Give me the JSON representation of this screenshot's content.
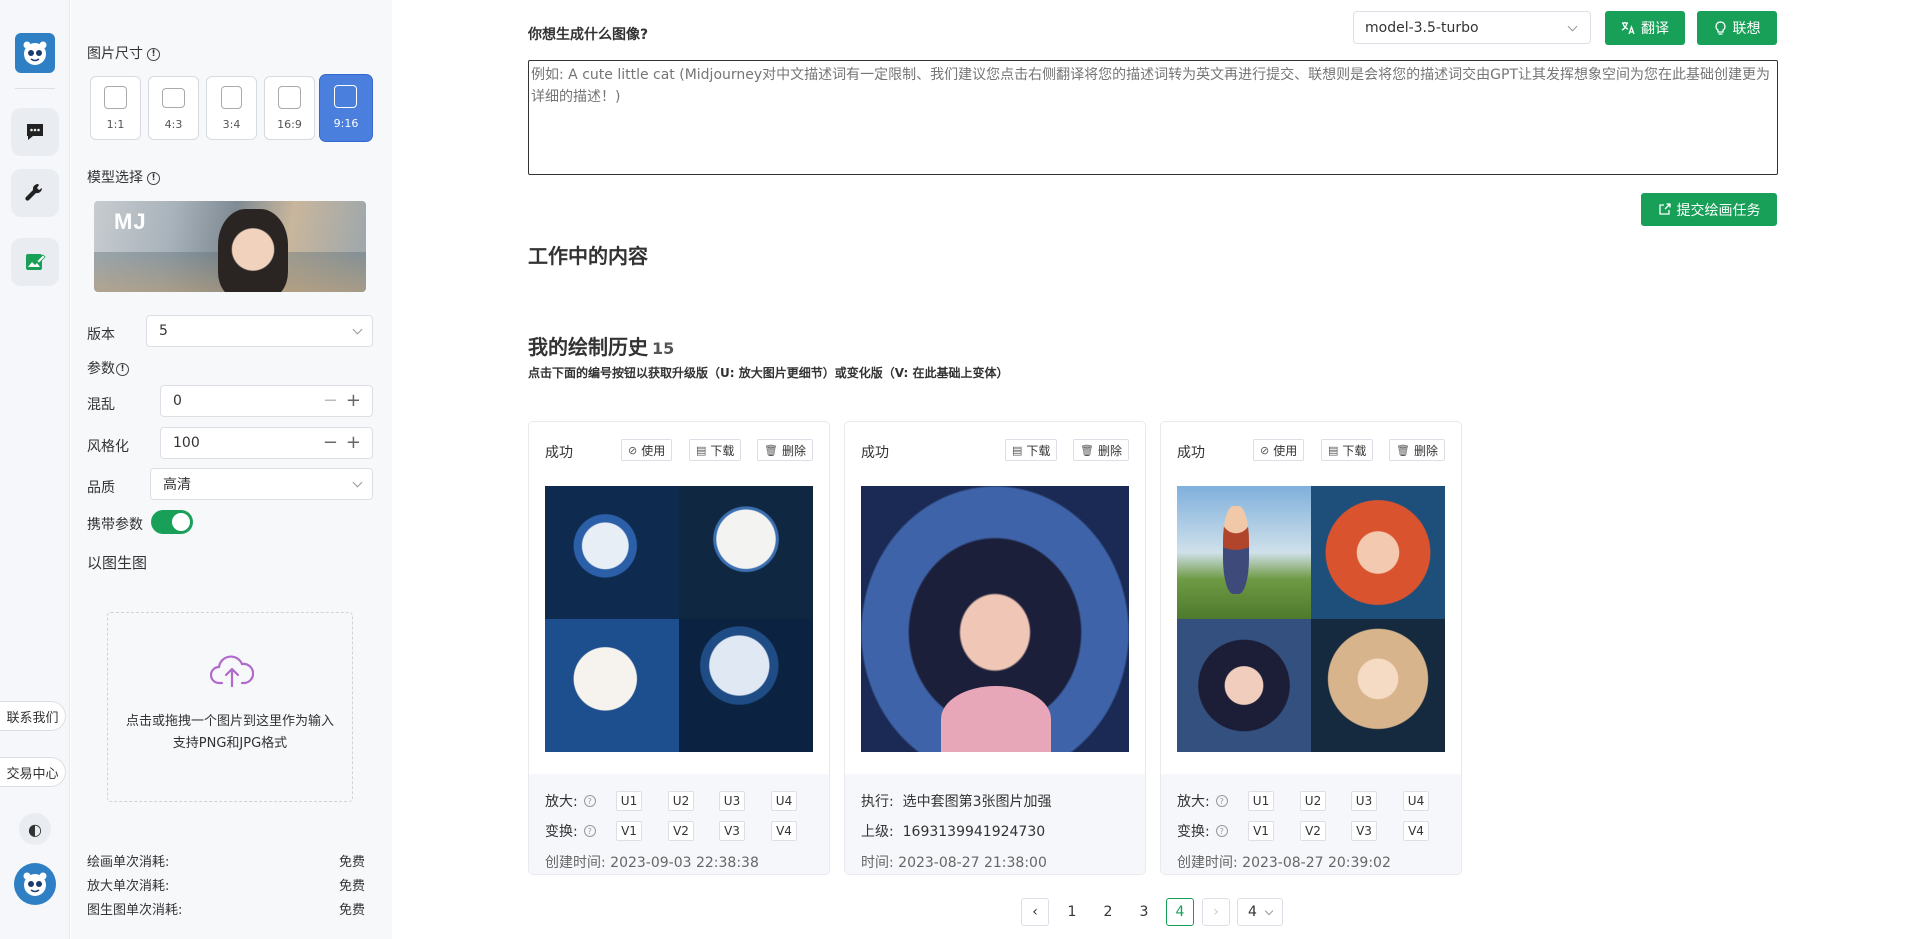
{
  "sidebar_rail": {
    "contact_label": "联系我们",
    "trade_label": "交易中心",
    "theme_glyph": "◐"
  },
  "settings": {
    "size_label": "图片尺寸",
    "ratios": [
      "1:1",
      "4:3",
      "3:4",
      "16:9",
      "9:16"
    ],
    "selected_ratio": "9:16",
    "model_label": "模型选择",
    "model_badge": "MJ",
    "version_label": "版本",
    "version_value": "5",
    "params_label": "参数",
    "chaos_label": "混乱",
    "chaos_value": "0",
    "stylize_label": "风格化",
    "stylize_value": "100",
    "quality_label": "品质",
    "quality_value": "高清",
    "carry_label": "携带参数",
    "carry_on": true,
    "img2img_label": "以图生图",
    "upload_text_1": "点击或拖拽一个图片到这里作为输入",
    "upload_text_2": "支持PNG和JPG格式",
    "costs": [
      {
        "label": "绘画单次消耗:",
        "value": "免费"
      },
      {
        "label": "放大单次消耗:",
        "value": "免费"
      },
      {
        "label": "图生图单次消耗:",
        "value": "免费"
      }
    ]
  },
  "main": {
    "question": "你想生成什么图像?",
    "model_value": "model-3.5-turbo",
    "translate_label": "翻译",
    "associate_label": "联想",
    "prompt_placeholder": "例如: A cute little cat (Midjourney对中文描述词有一定限制、我们建议您点击右侧翻译将您的描述词转为英文再进行提交、联想则是会将您的描述词交由GPT让其发挥想象空间为您在此基础创建更为详细的描述！)",
    "submit_label": "提交绘画任务",
    "working_title": "工作中的内容",
    "history_title": "我的绘制历史",
    "history_count": "15",
    "history_hint": "点击下面的编号按钮以获取升级版（U: 放大图片更细节）或变化版（V: 在此基础上变体）"
  },
  "cards": [
    {
      "status": "成功",
      "use_label": "使用",
      "download_label": "下载",
      "delete_label": "删除",
      "upscale_label": "放大:",
      "variation_label": "变换:",
      "u_buttons": [
        "U1",
        "U2",
        "U3",
        "U4"
      ],
      "v_buttons": [
        "V1",
        "V2",
        "V3",
        "V4"
      ],
      "time_label": "创建时间:",
      "time_value": "2023-09-03 22:38:38"
    },
    {
      "status": "成功",
      "download_label": "下载",
      "delete_label": "删除",
      "exec_label": "执行:",
      "exec_value": "选中套图第3张图片加强",
      "parent_label": "上级:",
      "parent_value": "1693139941924730",
      "time_label": "时间:",
      "time_value": "2023-08-27 21:38:00"
    },
    {
      "status": "成功",
      "use_label": "使用",
      "download_label": "下载",
      "delete_label": "删除",
      "upscale_label": "放大:",
      "variation_label": "变换:",
      "u_buttons": [
        "U1",
        "U2",
        "U3",
        "U4"
      ],
      "v_buttons": [
        "V1",
        "V2",
        "V3",
        "V4"
      ],
      "time_label": "创建时间:",
      "time_value": "2023-08-27 20:39:02"
    }
  ],
  "pagination": {
    "prev": "‹",
    "pages": [
      "1",
      "2",
      "3",
      "4"
    ],
    "current": "4",
    "next": "›",
    "page_size_value": "4"
  },
  "colors": {
    "accent_green": "#18a058",
    "selected_blue": "#4a7fdd",
    "logo_blue": "#2e7fc4"
  }
}
